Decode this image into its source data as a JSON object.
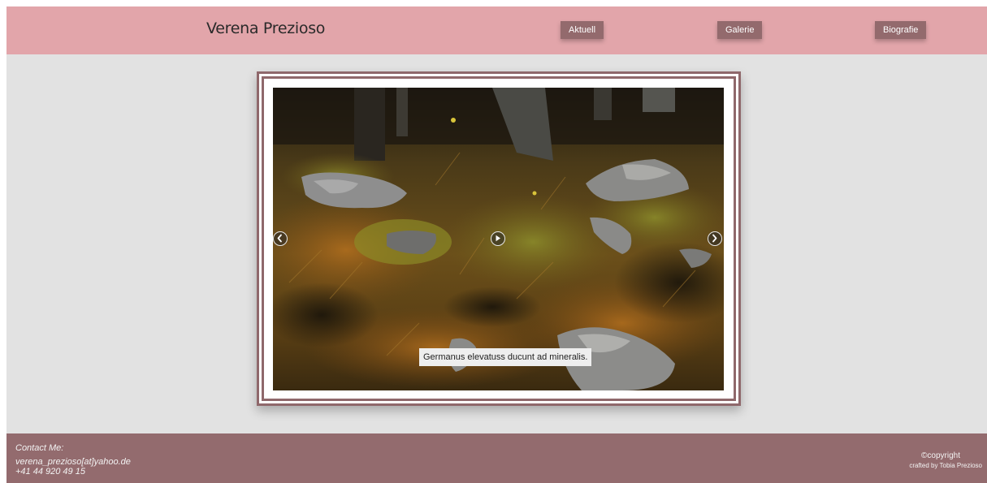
{
  "header": {
    "title": "Verena Prezioso",
    "nav": [
      {
        "label": "Aktuell"
      },
      {
        "label": "Galerie"
      },
      {
        "label": "Biografie"
      }
    ]
  },
  "gallery": {
    "caption": "Germanus elevatuss ducunt ad mineralis.",
    "controls": {
      "prev_icon": "chevron-left-icon",
      "play_icon": "play-icon",
      "next_icon": "chevron-right-icon"
    }
  },
  "footer": {
    "contact_label": "Contact Me:",
    "email": "verena_prezioso[at]yahoo.de",
    "phone": "+41 44 920 49 15",
    "copyright": "©copyright",
    "crafted_by": "crafted by Tobia Prezioso"
  },
  "colors": {
    "header_bg": "#e2a5aa",
    "accent": "#936a6d",
    "page_bg": "#e2e2e2"
  }
}
